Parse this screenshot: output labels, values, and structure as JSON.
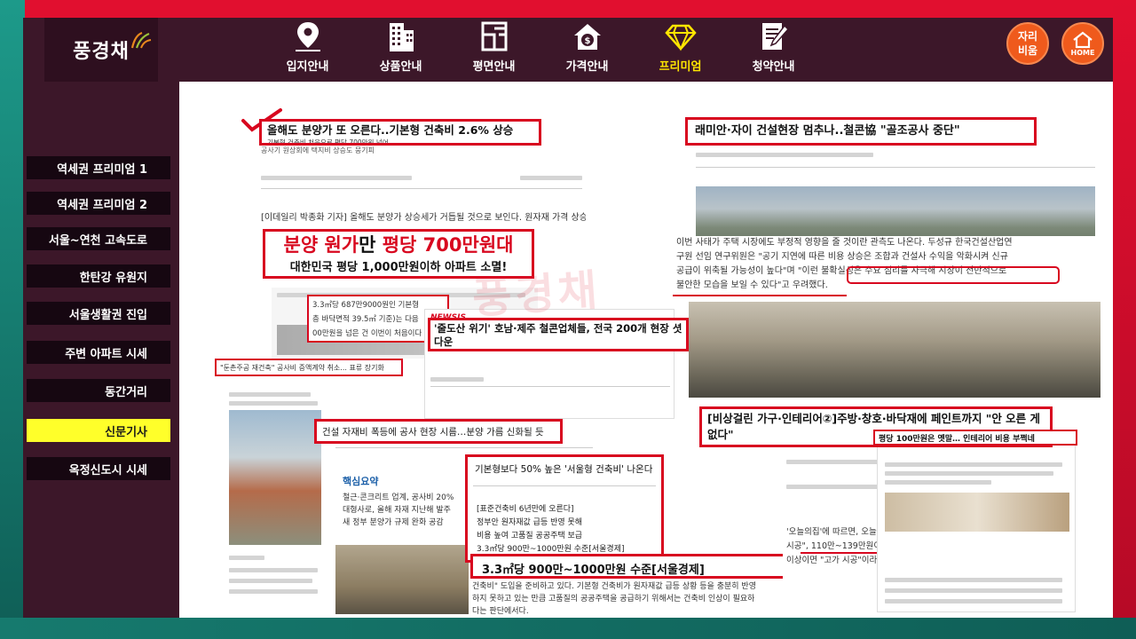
{
  "brand": {
    "logo": "풍경채"
  },
  "nav": {
    "items": [
      {
        "label": "입지안내",
        "icon": "map-pin-icon"
      },
      {
        "label": "상품안내",
        "icon": "building-icon"
      },
      {
        "label": "평면안내",
        "icon": "floorplan-icon"
      },
      {
        "label": "가격안내",
        "icon": "price-house-icon"
      },
      {
        "label": "프리미엄",
        "icon": "diamond-icon",
        "active": true
      },
      {
        "label": "청약안내",
        "icon": "document-pen-icon"
      }
    ],
    "btn_seat": "자리\n비움",
    "btn_home": "HOME",
    "active_color": "#ffe600"
  },
  "sidebar": {
    "items": [
      {
        "label": "역세권 프리미엄 1"
      },
      {
        "label": "역세권 프리미엄 2"
      },
      {
        "label": "서울~연천 고속도로"
      },
      {
        "label": "한탄강 유원지"
      },
      {
        "label": "서울생활권 진입"
      },
      {
        "label": "주변 아파트 시세"
      },
      {
        "label": "동간거리"
      },
      {
        "label": "신문기사",
        "active": true
      },
      {
        "label": "옥정신도시 시세"
      }
    ]
  },
  "articles": {
    "a1": {
      "headline": "올해도 분양가 또 오른다..기본형 건축비 2.6% 상승",
      "sub": "기본형 건축비 처음으로 평당 700만원 넘어",
      "sub2": "공사기 원상회에 택지비 상승도 뭉기피",
      "lead": "[이데일리 박종화 기자] 올해도 분양가 상승세가 거듭될 것으로 보인다. 원자재 가격 상승고",
      "callout_title": "분양 원가만 평당 700만원대",
      "callout_title_red1": "분양 원가",
      "callout_title_black": "만 ",
      "callout_title_red2": "평당 700만원대",
      "callout_sub": "대한민국 평당 1,000만원이하 아파트 소멸!",
      "snip1": "3.3㎡당 687만9000원인 기본형",
      "snip2": "층 바닥면적 39.5㎡ 기준)는 다음",
      "snip3": "00만원을 넘은 건 이번이 처음이다"
    },
    "a2": {
      "headline": "래미안·자이 건설현장 멈추나..철콘協 \"골조공사 중단\"",
      "body": [
        "이번 사태가 주택 시장에도 부정적 영향을 줄 것이란 관측도 나온다. 두성규 한국건설산업연",
        "구원 선임 연구위원은 \"공기 지연에 따른 비용 상승은 조합과 건설사 수익을 악화시켜 신규",
        "공급이 위축될 가능성이 높다\"며 \"이런 불확실성은 수요 심리를 자극해 시장이 전반적으로",
        "불안한 모습을 보일 수 있다\"고 우려했다."
      ]
    },
    "a3": {
      "source": "NEWSIS",
      "headline": "'줄도산 위기' 호남·제주 철콘업체들, 전국 200개 현장 셧다운"
    },
    "a4": {
      "headline": "\"둔촌주공 재건축\" 공사비 증액계약 취소... 표류 장기화"
    },
    "a5": {
      "headline": "건설 자재비 폭등에 공사 현장 시름…분양 가름 신화될 듯",
      "summary_title": "핵심요약",
      "summary": [
        "철근·콘크리트 업계, 공사비 20%",
        "대형사로, 올해 자재 지난해 발주",
        "새 정부 분양가 규제 완화 공감"
      ]
    },
    "a6": {
      "headline": "기본형보다 50% 높은 '서울형 건축비' 나온다",
      "box_title": "[표준건축비 6년만에 오른다]",
      "bullets": [
        "정부안 원자재값 급등 반영 못해",
        "비용 높여 고품질 공공주택 보급",
        "3.3㎡당 900만~1000만원 수준[서울경제]"
      ],
      "callout": "3.3㎡당 900만~1000만원 수준[서울경제]",
      "footer": [
        "건축비\" 도입을 준비하고 있다. 기본형 건축비가 원자재값 급등 상황 등을 충분히 반영",
        "하지 못하고 있는 만큼 고품질의 공공주택을 공급하기 위해서는 건축비 인상이 필요하",
        "다는 판단에서다."
      ]
    },
    "a7": {
      "headline": "[비상걸린 가구·인테리어②]주방·창호·바닥재에 페인트까지 \"안 오른 게 없다\"",
      "sub": "평당 100만원은 옛말… 인테리어 비용 부쩍네",
      "body": [
        "'오늘의집'에 따르면, 오늘의집은 평당 인테리어 시공 가격이",
        "시공\", 110만~139만원이면 \"중저가 시공\", 140만~179만원이면",
        "이상이면 \"고가 시공\"이라고 분류하고 있다. 2~3년만 해도 평"
      ]
    },
    "watermark": "풍경채"
  }
}
